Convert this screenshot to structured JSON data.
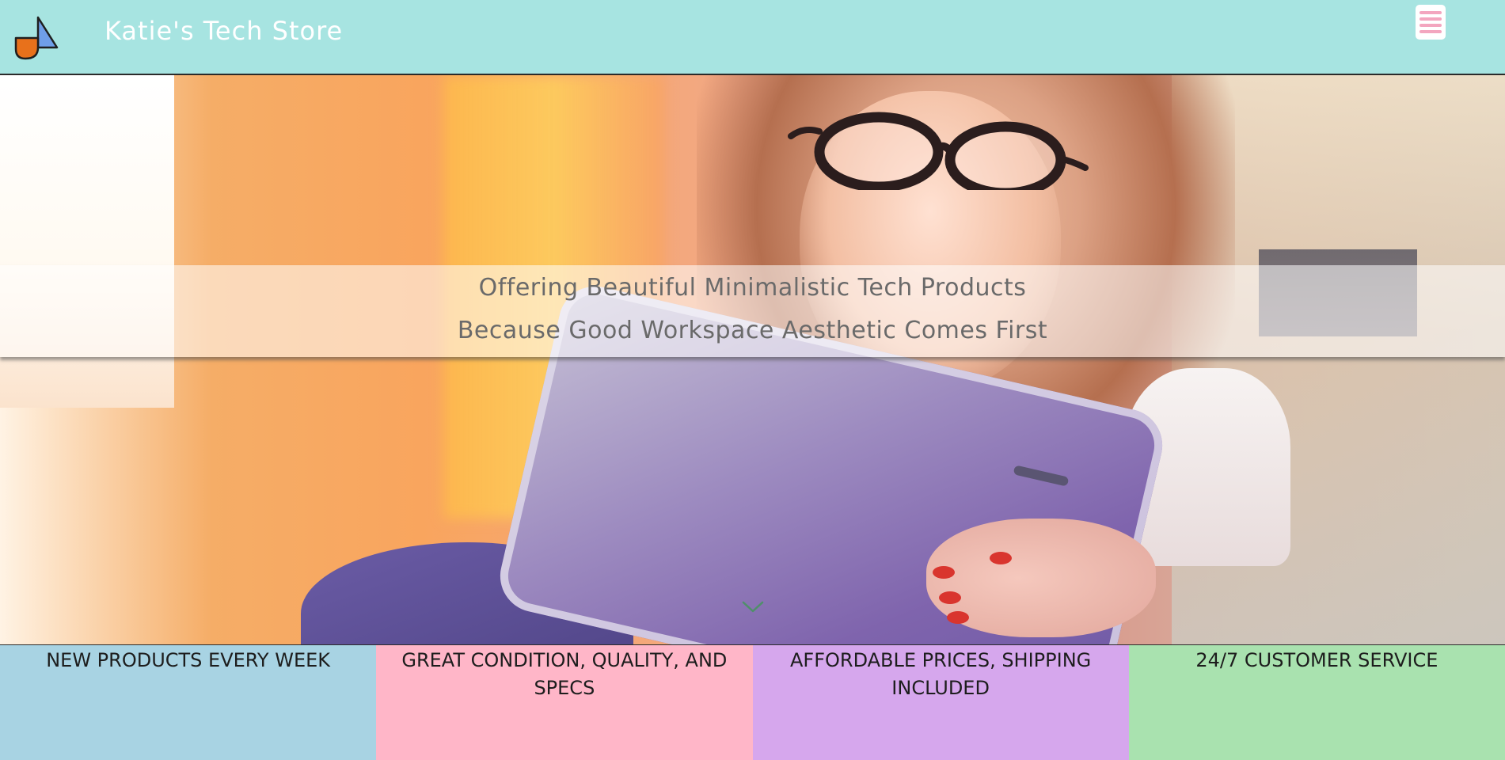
{
  "header": {
    "brand": "Katie's Tech Store",
    "logo_icon": "store-logo-icon",
    "menu_icon": "hamburger-menu-icon",
    "colors": {
      "background": "#a7e4e1",
      "brand_text": "#ffffff",
      "menu_bars": "#f3a6bf"
    }
  },
  "hero": {
    "image": "woman-with-tablet-photo",
    "tagline_line1": "Offering Beautiful Minimalistic Tech Products",
    "tagline_line2": "Because Good Workspace Aesthetic Comes First",
    "scroll_icon": "chevron-down-icon"
  },
  "features": [
    {
      "label": "NEW PRODUCTS EVERY WEEK",
      "color": "#a8d3e3"
    },
    {
      "label": "GREAT CONDITION, QUALITY, AND SPECS",
      "color": "#ffb6c8"
    },
    {
      "label": "AFFORDABLE PRICES, SHIPPING INCLUDED",
      "color": "#d6a7ed"
    },
    {
      "label": "24/7 CUSTOMER SERVICE",
      "color": "#a9e2af"
    }
  ]
}
